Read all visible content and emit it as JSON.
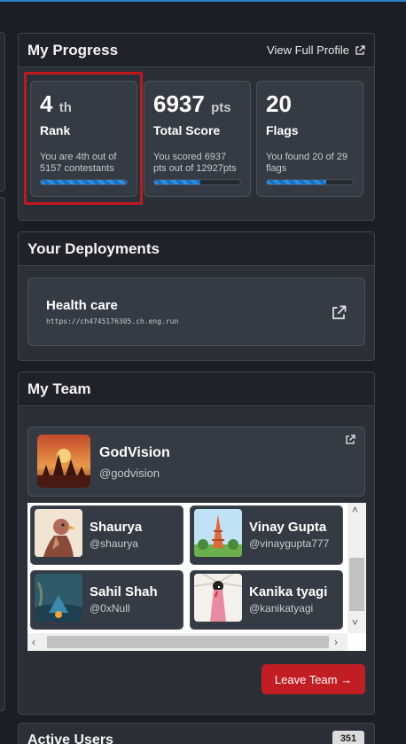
{
  "progress": {
    "title": "My Progress",
    "view_profile": "View Full Profile",
    "stats": [
      {
        "value": "4",
        "unit": "th",
        "label": "Rank",
        "desc": "You are 4th out of 5157 contestants",
        "progress": 1.0
      },
      {
        "value": "6937",
        "unit": "pts",
        "label": "Total Score",
        "desc": "You scored 6937 pts out of 12927pts",
        "progress": 0.54
      },
      {
        "value": "20",
        "unit": "",
        "label": "Flags",
        "desc": "You found 20 of 29 flags",
        "progress": 0.69
      }
    ]
  },
  "deployments": {
    "title": "Your Deployments",
    "items": [
      {
        "name": "Health care",
        "url": "https://ch4745176305.ch.eng.run"
      }
    ]
  },
  "team": {
    "title": "My Team",
    "name": "GodVision",
    "handle": "@godvision",
    "members": [
      {
        "name": "Shaurya",
        "handle": "@shaurya"
      },
      {
        "name": "Vinay Gupta",
        "handle": "@vinaygupta777"
      },
      {
        "name": "Sahil Shah",
        "handle": "@0xNull"
      },
      {
        "name": "Kanika tyagi",
        "handle": "@kanikatyagi"
      }
    ],
    "leave_button": "Leave Team →"
  },
  "active_users": {
    "title": "Active Users",
    "count": "351"
  },
  "colors": {
    "accent": "#2d8fe0",
    "danger": "#c21d22",
    "highlight": "#c0181f"
  }
}
